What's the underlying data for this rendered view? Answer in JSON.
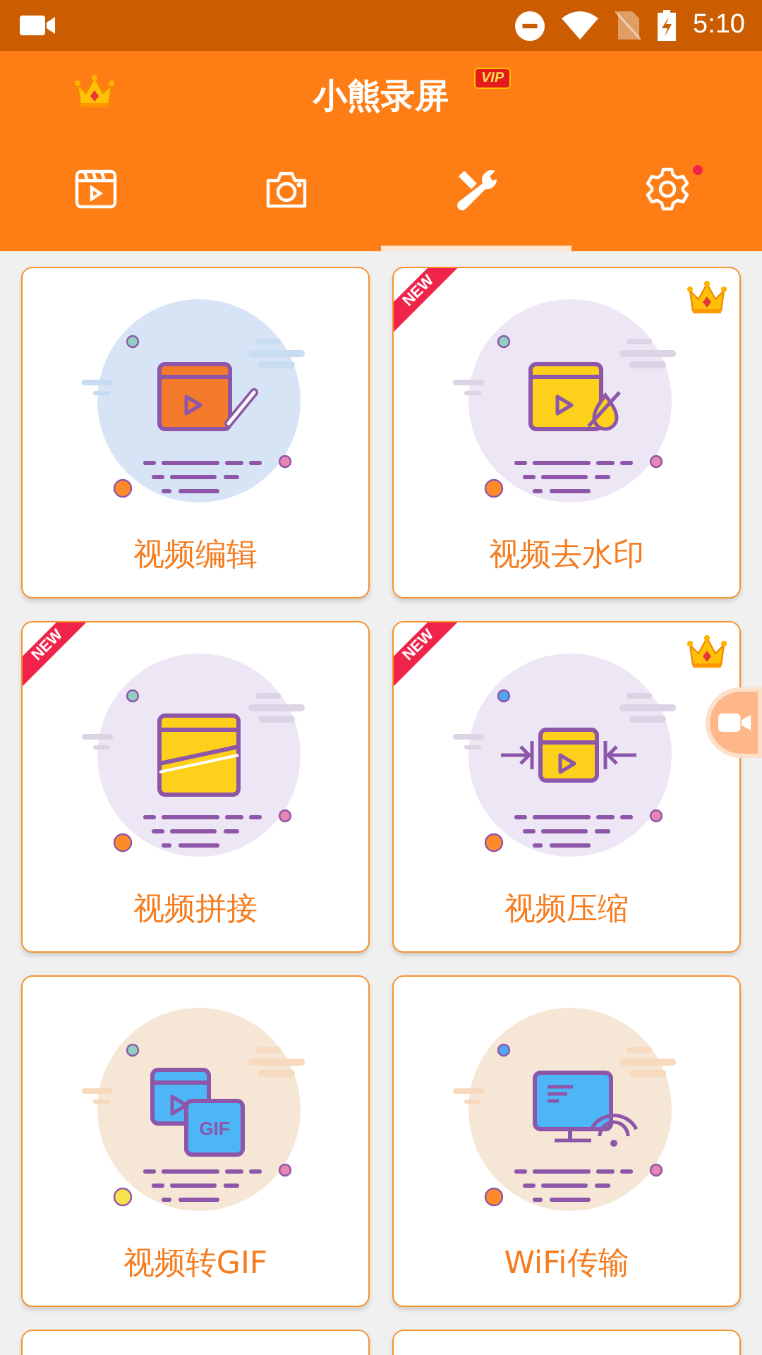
{
  "status_bar": {
    "time": "5:10"
  },
  "header": {
    "title": "小熊录屏",
    "vip_badge": "VIP"
  },
  "tabs": [
    {
      "kind": "video",
      "selected": false,
      "badge": false
    },
    {
      "kind": "camera",
      "selected": false,
      "badge": false
    },
    {
      "kind": "tools",
      "selected": true,
      "badge": false
    },
    {
      "kind": "settings",
      "selected": false,
      "badge": true
    }
  ],
  "tools": [
    {
      "kind": "edit",
      "label": "视频编辑",
      "vip": false
    },
    {
      "kind": "watermark",
      "label": "视频去水印",
      "ribbon": "NEW",
      "vip": true
    },
    {
      "kind": "merge",
      "label": "视频拼接",
      "ribbon": "NEW",
      "vip": false
    },
    {
      "kind": "compress",
      "label": "视频压缩",
      "ribbon": "NEW",
      "vip": true
    },
    {
      "kind": "gif",
      "label": "视频转GIF",
      "vip": false,
      "gif_text": "GIF"
    },
    {
      "kind": "wifi",
      "label": "WiFi传输",
      "vip": false
    },
    {
      "kind": "cut"
    },
    {
      "kind": "cut"
    }
  ]
}
